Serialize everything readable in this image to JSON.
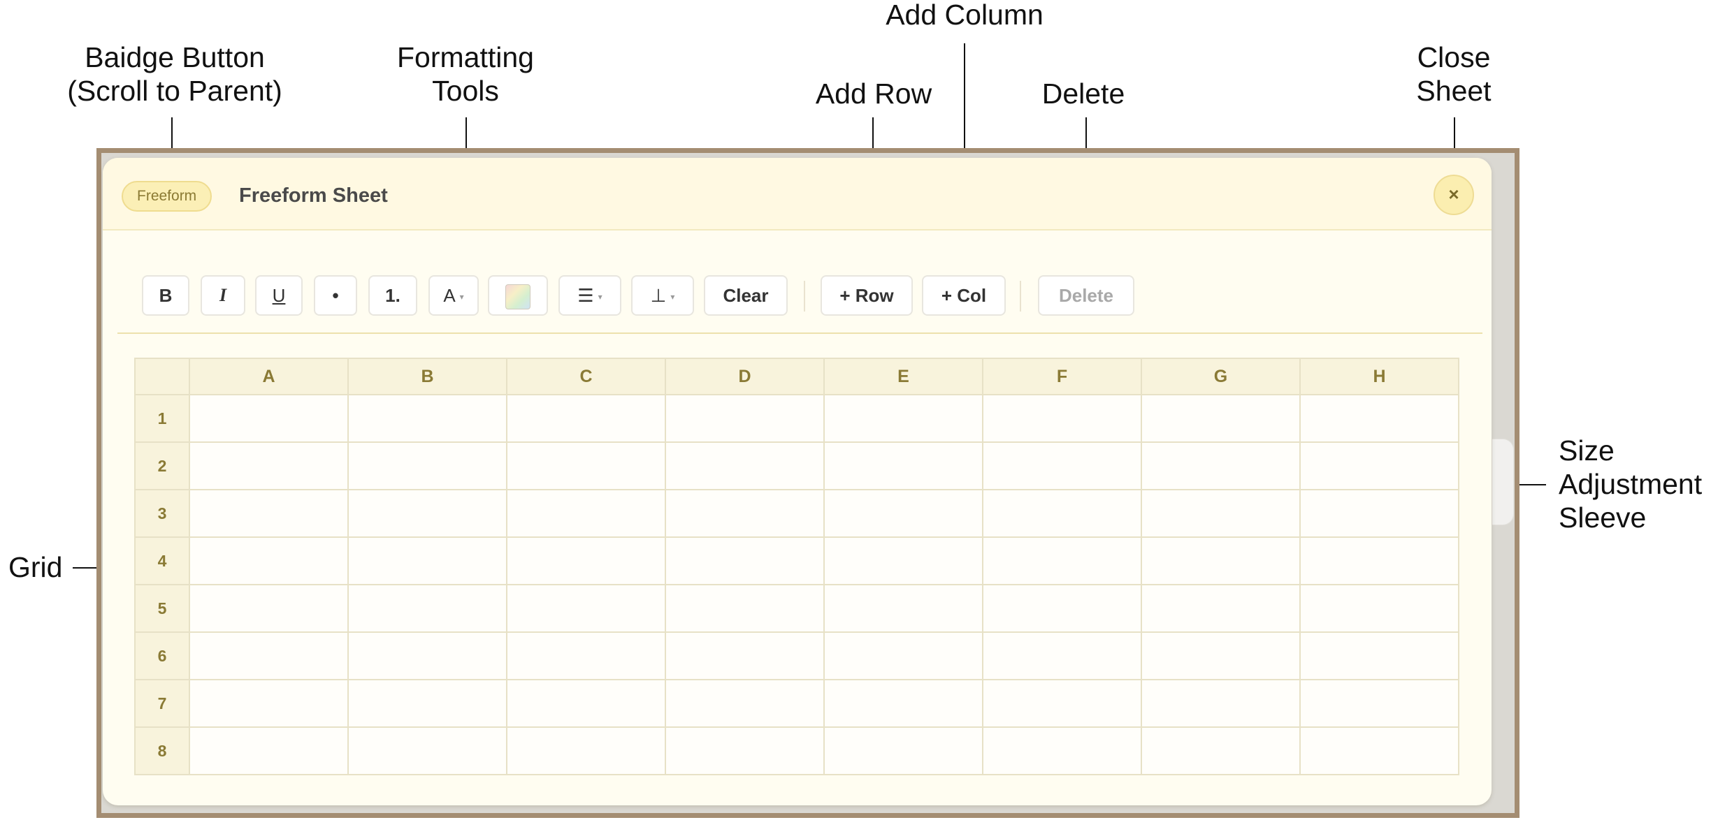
{
  "annotations": {
    "badge_button": [
      "Baidge Button",
      "(Scroll to Parent)"
    ],
    "formatting_tools": [
      "Formatting",
      "Tools"
    ],
    "add_column": "Add Column",
    "add_row": "Add Row",
    "delete": "Delete",
    "close_sheet": [
      "Close",
      "Sheet"
    ],
    "size_adjustment_sleeve": [
      "Size",
      "Adjustment",
      "Sleeve"
    ],
    "grid": "Grid"
  },
  "sheet": {
    "badge": "Freeform",
    "title": "Freeform Sheet",
    "close_symbol": "×"
  },
  "toolbar": {
    "bold": "B",
    "italic": "I",
    "underline": "U",
    "bullet_list": "•",
    "numbered_list": "1.",
    "text_size": "A",
    "align": "☰",
    "valign": "⊥",
    "clear": "Clear",
    "add_row": "+ Row",
    "add_col": "+ Col",
    "delete": "Delete"
  },
  "grid": {
    "columns": [
      "A",
      "B",
      "C",
      "D",
      "E",
      "F",
      "G",
      "H"
    ],
    "rows": [
      "1",
      "2",
      "3",
      "4",
      "5",
      "6",
      "7",
      "8"
    ]
  },
  "colors": {
    "frame": "#a48d72",
    "sheet_background": "#fffdf1",
    "header_background": "#fff9e2",
    "badge_fill": "#fbefb6",
    "grid_header": "#f8f3dc",
    "header_text": "#8a7a35"
  }
}
